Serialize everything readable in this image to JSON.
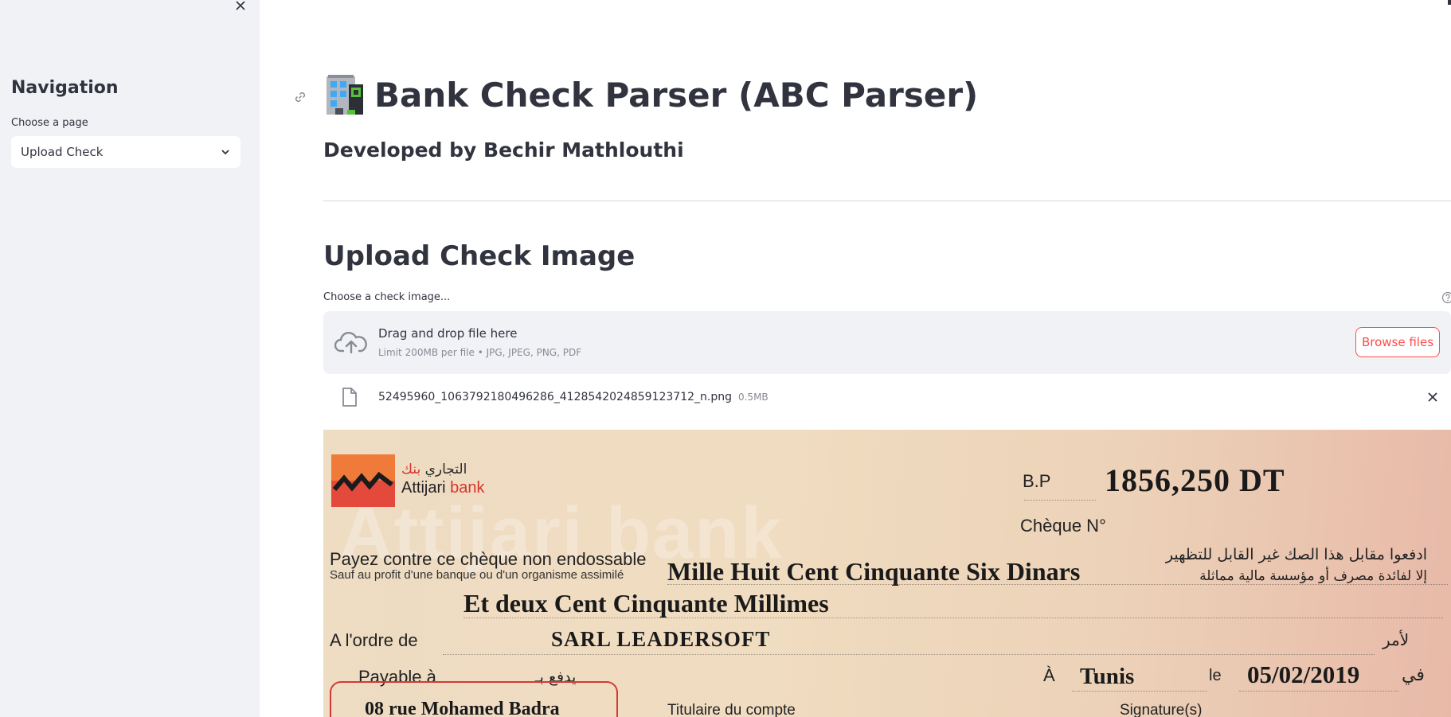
{
  "sidebar": {
    "close_icon": "close-icon",
    "title": "Navigation",
    "select_label": "Choose a page",
    "select_value": "Upload Check"
  },
  "header": {
    "title": "Bank Check Parser (ABC Parser)",
    "title_icon": "office-building-icon",
    "subtitle": "Developed by Bechir Mathlouthi"
  },
  "upload": {
    "section_title": "Upload Check Image",
    "label": "Choose a check image...",
    "dropzone_text": "Drag and drop file here",
    "dropzone_limit": "Limit 200MB per file • JPG, JPEG, PNG, PDF",
    "browse_label": "Browse files",
    "file": {
      "name": "52495960_1063792180496286_4128542024859123712_n.png",
      "size": "0.5MB"
    }
  },
  "check_image": {
    "bank_arabic": "التجاري",
    "bank_arabic_red": "بنك",
    "bank_latin": "Attijari",
    "bank_latin_red": "bank",
    "watermark": "Attijari bank",
    "bp_label": "B.P",
    "amount": "1856,250 DT",
    "cheque_no_label": "Chèque N°",
    "payez_label": "Payez contre ce chèque non endossable",
    "sauf_label": "Sauf au profit d'une banque ou d'un organisme assimilé",
    "arabic_line_1": "ادفعوا مقابل هذا الصك غير القابل للتظهير",
    "arabic_line_2": "إلا لفائدة مصرف أو مؤسسة مالية مماثلة",
    "amount_words_1": "Mille Huit Cent Cinquante Six Dinars",
    "amount_words_2": "Et deux Cent Cinquante Millimes",
    "ordre_label": "A l'ordre de",
    "payee": "SARL LEADERSOFT",
    "lamr": "لأمر",
    "payable_label": "Payable à",
    "payable_arabic": "يدفع بـ",
    "address": "08 rue Mohamed Badra",
    "a_label": "À",
    "city": "Tunis",
    "le_label": "le",
    "date": "05/02/2019",
    "fi": "في",
    "titulaire_label": "Titulaire du compte",
    "signature_label": "Signature(s)"
  },
  "colors": {
    "sidebar_bg": "#f0f2f6",
    "accent": "#ff4b4b",
    "text": "#31333f",
    "muted": "#888b94"
  }
}
